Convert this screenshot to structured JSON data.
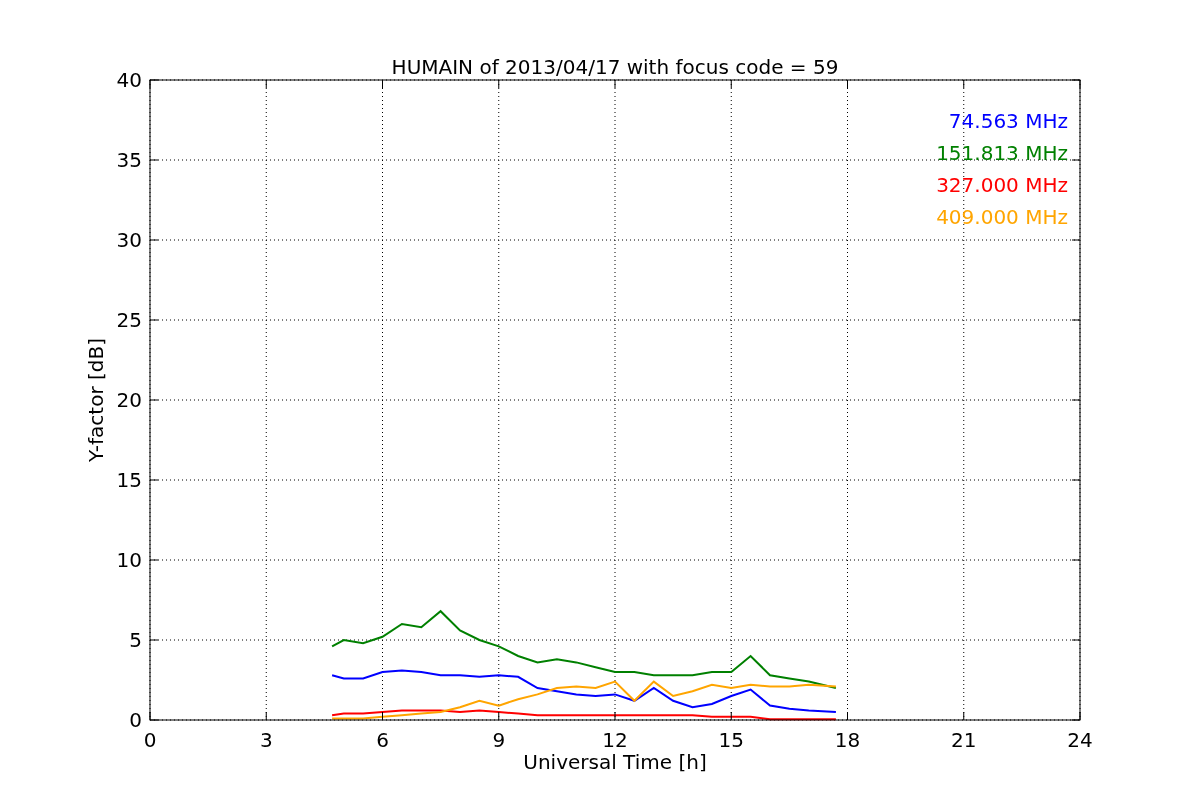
{
  "chart_data": {
    "type": "line",
    "title": "HUMAIN of 2013/04/17 with focus code = 59",
    "xlabel": "Universal Time [h]",
    "ylabel": "Y-factor [dB]",
    "x": [
      4.7,
      5,
      5.5,
      6,
      6.5,
      7,
      7.5,
      8,
      8.5,
      9,
      9.5,
      10,
      10.5,
      11,
      11.5,
      12,
      12.5,
      13,
      13.5,
      14,
      14.5,
      15,
      15.5,
      16,
      16.5,
      17,
      17.7
    ],
    "series": [
      {
        "name": "74.563 MHz",
        "color": "#0000ff",
        "values": [
          2.8,
          2.6,
          2.6,
          3.0,
          3.1,
          3.0,
          2.8,
          2.8,
          2.7,
          2.8,
          2.7,
          2.0,
          1.8,
          1.6,
          1.5,
          1.6,
          1.2,
          2.0,
          1.2,
          0.8,
          1.0,
          1.5,
          1.9,
          0.9,
          0.7,
          0.6,
          0.5
        ]
      },
      {
        "name": "151.813 MHz",
        "color": "#008000",
        "values": [
          4.6,
          5.0,
          4.8,
          5.2,
          6.0,
          5.8,
          6.8,
          5.6,
          5.0,
          4.6,
          4.0,
          3.6,
          3.8,
          3.6,
          3.3,
          3.0,
          3.0,
          2.8,
          2.8,
          2.8,
          3.0,
          3.0,
          4.0,
          2.8,
          2.6,
          2.4,
          2.0
        ]
      },
      {
        "name": "327.000 MHz",
        "color": "#ff0000",
        "values": [
          0.3,
          0.4,
          0.4,
          0.5,
          0.6,
          0.6,
          0.6,
          0.5,
          0.6,
          0.5,
          0.4,
          0.3,
          0.3,
          0.3,
          0.3,
          0.3,
          0.3,
          0.3,
          0.3,
          0.3,
          0.2,
          0.2,
          0.2,
          0.05,
          0.05,
          0.05,
          0.05
        ]
      },
      {
        "name": "409.000 MHz",
        "color": "#ffa500",
        "values": [
          0.1,
          0.1,
          0.1,
          0.2,
          0.3,
          0.4,
          0.5,
          0.8,
          1.2,
          0.9,
          1.3,
          1.6,
          2.0,
          2.1,
          2.0,
          2.4,
          1.2,
          2.4,
          1.5,
          1.8,
          2.2,
          2.0,
          2.2,
          2.1,
          2.1,
          2.2,
          2.1
        ]
      }
    ],
    "grid": true,
    "xlim": [
      0,
      24
    ],
    "ylim": [
      0,
      40
    ],
    "xticks": [
      0,
      3,
      6,
      9,
      12,
      15,
      18,
      21,
      24
    ],
    "yticks": [
      0,
      5,
      10,
      15,
      20,
      25,
      30,
      35,
      40
    ]
  }
}
